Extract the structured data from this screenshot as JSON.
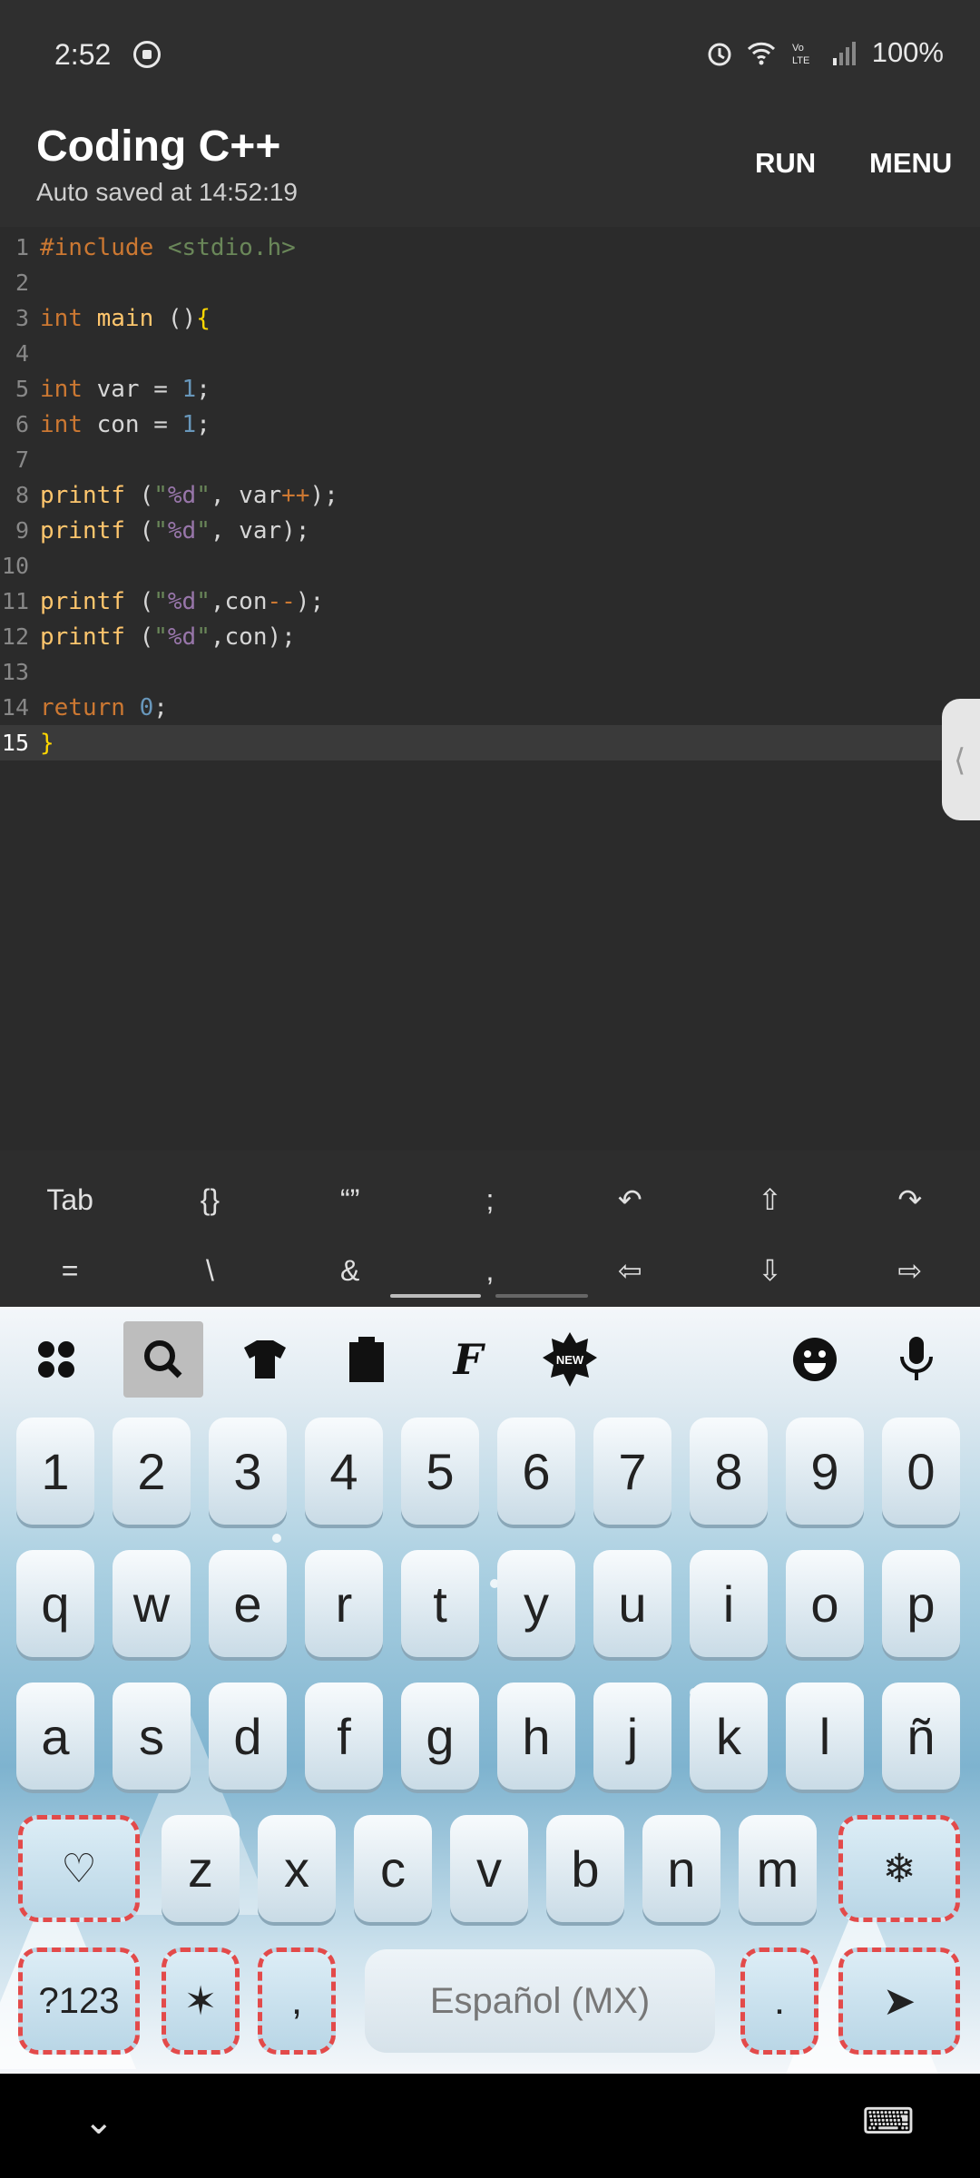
{
  "status": {
    "time": "2:52",
    "battery": "100%",
    "icons": [
      "screen-record-icon",
      "alarm-icon",
      "wifi-icon",
      "volte-icon",
      "signal-icon"
    ]
  },
  "appbar": {
    "title": "Coding C++",
    "subtitle": "Auto saved at 14:52:19",
    "run_label": "RUN",
    "menu_label": "MENU"
  },
  "editor": {
    "line_numbers": [
      "1",
      "2",
      "3",
      "4",
      "5",
      "6",
      "7",
      "8",
      "9",
      "10",
      "11",
      "12",
      "13",
      "14",
      "15"
    ],
    "current_line": 15
  },
  "code_tokens": {
    "l1_kw": "#include",
    "l1_str": " <stdio.h>",
    "l3_kw": "int",
    "l3_fn": " main",
    "l3_rest": " ()",
    "l3_brace": "{",
    "l5_kw": "int",
    "l5_rest": " var = ",
    "l5_num": "1",
    "l5_end": ";",
    "l6_kw": "int",
    "l6_rest": " con = ",
    "l6_num": "1",
    "l6_end": ";",
    "l8_fn": "printf",
    "l8_a": " (",
    "l8_q1": "\"",
    "l8_pct": "%d",
    "l8_q2": "\"",
    "l8_b": ", var",
    "l8_op": "++",
    "l8_c": ");",
    "l9_fn": "printf",
    "l9_a": " (",
    "l9_q1": "\"",
    "l9_pct": "%d",
    "l9_q2": "\"",
    "l9_b": ", var);",
    "l11_fn": "printf",
    "l11_a": " (",
    "l11_q1": "\"",
    "l11_pct": "%d",
    "l11_q2": "\"",
    "l11_b": ",con",
    "l11_op": "--",
    "l11_c": ");",
    "l12_fn": "printf",
    "l12_a": " (",
    "l12_q1": "\"",
    "l12_pct": "%d",
    "l12_q2": "\"",
    "l12_b": ",con);",
    "l14_kw": "return",
    "l14_sp": " ",
    "l14_num": "0",
    "l14_end": ";",
    "l15_brace": "}"
  },
  "toolbar": {
    "row1": [
      "Tab",
      "{}",
      "“”",
      ";",
      "↶",
      "⇧",
      "↷"
    ],
    "row2": [
      "=",
      "\\",
      "&",
      ",",
      "⇦",
      "⇩",
      "⇨"
    ]
  },
  "keyboard": {
    "numbers": [
      "1",
      "2",
      "3",
      "4",
      "5",
      "6",
      "7",
      "8",
      "9",
      "0"
    ],
    "row_q": [
      "q",
      "w",
      "e",
      "r",
      "t",
      "y",
      "u",
      "i",
      "o",
      "p"
    ],
    "row_a": [
      "a",
      "s",
      "d",
      "f",
      "g",
      "h",
      "j",
      "k",
      "l",
      "ñ"
    ],
    "row_z": [
      "z",
      "x",
      "c",
      "v",
      "b",
      "n",
      "m"
    ],
    "heart": "♡",
    "snowflake": "❄",
    "sym": "?123",
    "star": "✶",
    "comma": ",",
    "period": ".",
    "space_label": "Español (MX)",
    "enter": "➤",
    "top_icons": [
      "apps-icon",
      "search-icon",
      "theme-shirt-icon",
      "clipboard-icon",
      "font-icon",
      "new-badge-icon",
      "emoji-icon",
      "mic-icon"
    ],
    "new_badge": "NEW"
  },
  "nav": {
    "back": "⌄",
    "keyboard_switch": "⌨"
  },
  "colors": {
    "accent_red": "#e34a4a",
    "editor_bg": "#2b2b2b",
    "keyword": "#cc7832"
  }
}
